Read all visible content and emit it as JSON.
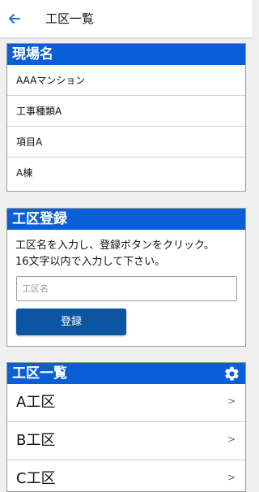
{
  "appbar": {
    "title": "工区一覧",
    "back_icon": "back-arrow-icon"
  },
  "site_card": {
    "header": "現場名",
    "rows": [
      "AAAマンション",
      "工事種類A",
      "項目A",
      "A棟"
    ]
  },
  "register_card": {
    "header": "工区登録",
    "instructions_line1": "工区名を入力し、登録ボタンをクリック。",
    "instructions_line2": "16文字以内で入力して下さい。",
    "input_placeholder": "工区名",
    "button_label": "登録"
  },
  "list_card": {
    "header": "工区一覧",
    "settings_icon": "gear-icon",
    "items": [
      {
        "label": "A工区",
        "chevron": ">"
      },
      {
        "label": "B工区",
        "chevron": ">"
      },
      {
        "label": "C工区",
        "chevron": ">"
      }
    ]
  },
  "colors": {
    "header_blue": "#0b5fd6",
    "button_blue": "#0c55a3",
    "accent_blue": "#1e6fd9"
  }
}
